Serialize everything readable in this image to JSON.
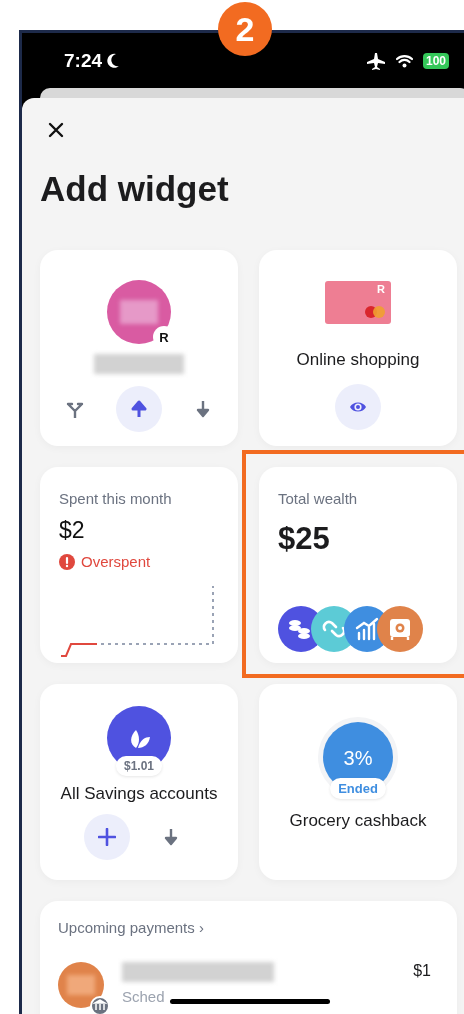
{
  "step_badge": "2",
  "status_bar": {
    "time": "7:24",
    "battery": "100"
  },
  "title": "Add widget",
  "widgets": [
    {
      "kind": "account",
      "badge": "R",
      "actions": [
        {
          "kind": "split",
          "primary": false
        },
        {
          "kind": "up",
          "primary": true
        },
        {
          "kind": "down",
          "primary": false
        }
      ]
    },
    {
      "kind": "card",
      "card_mark": "R",
      "label": "Online shopping",
      "actions": [
        {
          "kind": "eye",
          "primary": true
        }
      ]
    },
    {
      "kind": "spending",
      "label": "Spent this month",
      "amount": "$2",
      "status": "Overspent"
    },
    {
      "kind": "wealth",
      "label": "Total wealth",
      "amount": "$25",
      "highlighted": true,
      "icons": [
        {
          "kind": "coins",
          "color": "#4f52e0"
        },
        {
          "kind": "link",
          "color": "#5ccbd6"
        },
        {
          "kind": "chart",
          "color": "#3f8ee0"
        },
        {
          "kind": "safe",
          "color": "#e0834a"
        }
      ]
    },
    {
      "kind": "savings",
      "balance": "$1.01",
      "label": "All Savings accounts",
      "actions": [
        {
          "kind": "plus",
          "primary": true
        },
        {
          "kind": "down",
          "primary": false
        }
      ]
    },
    {
      "kind": "cashback",
      "rate": "3%",
      "status": "Ended",
      "label": "Grocery cashback"
    },
    {
      "kind": "payments",
      "label": "Upcoming payments",
      "chevron": "›",
      "rows": [
        {
          "subtitle": "Sched",
          "amount": "$1"
        }
      ]
    }
  ]
}
